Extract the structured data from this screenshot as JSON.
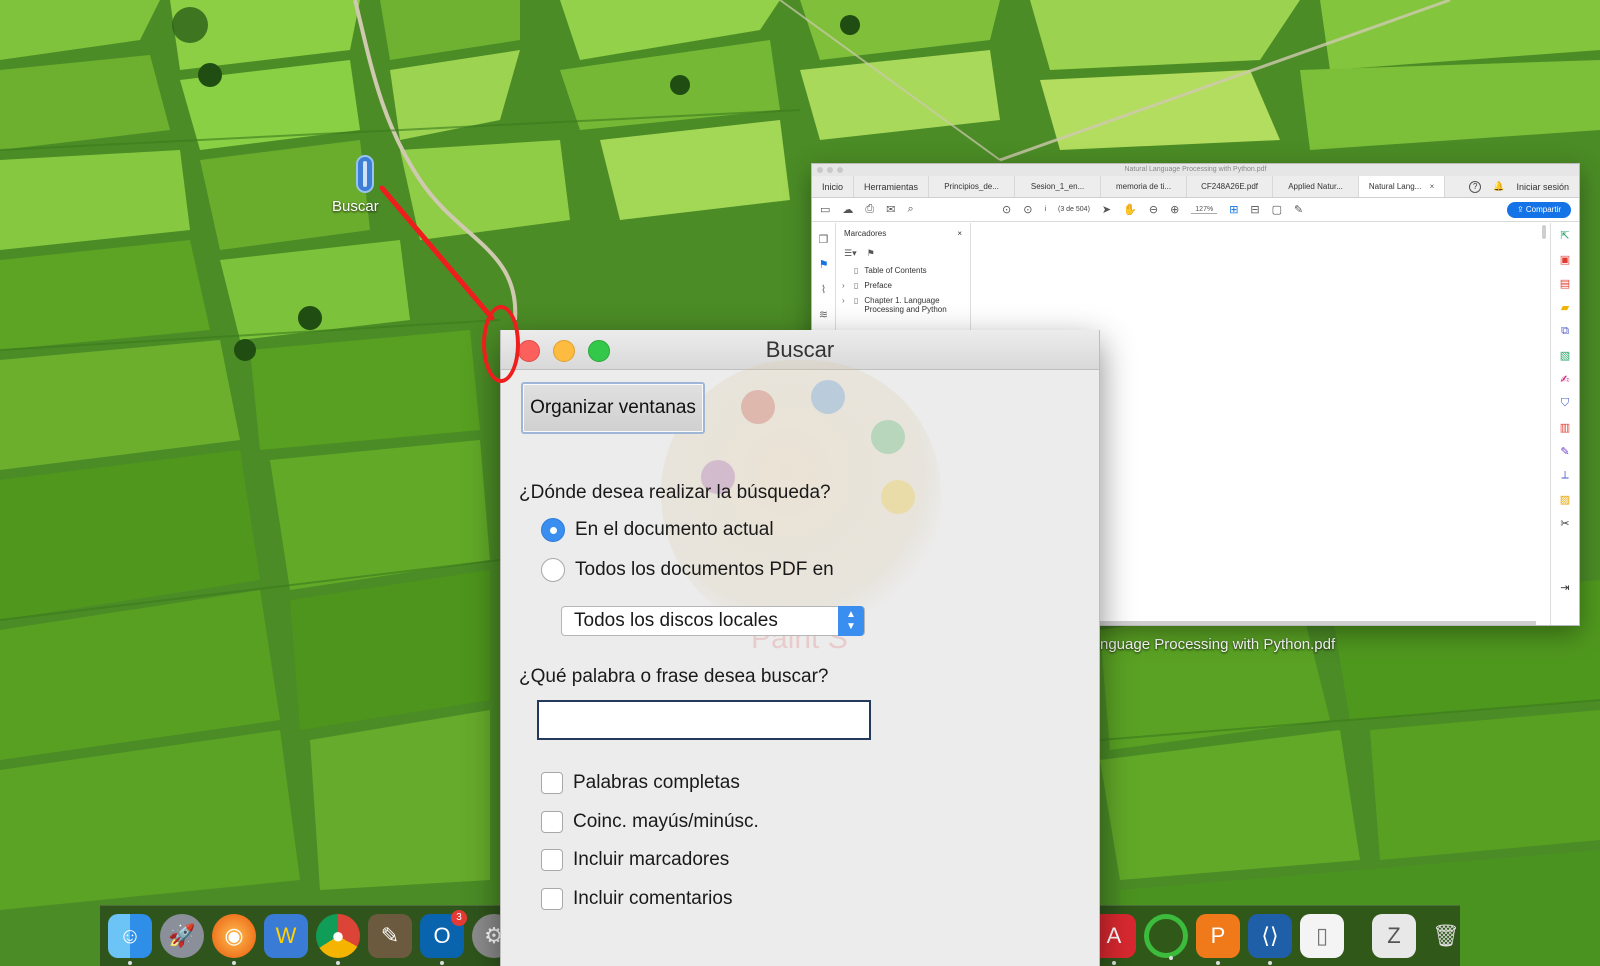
{
  "desktop": {
    "shortcut_label": "Buscar",
    "file_caption": "nguage Processing with Python.pdf"
  },
  "acrobat": {
    "title": "Natural Language Processing with Python.pdf",
    "tabs": [
      {
        "label": "Inicio"
      },
      {
        "label": "Herramientas"
      }
    ],
    "doc_tabs": [
      {
        "label": "Principios_de..."
      },
      {
        "label": "Sesion_1_en..."
      },
      {
        "label": "memoria de ti..."
      },
      {
        "label": "CF248A26E.pdf"
      },
      {
        "label": "Applied Natur..."
      },
      {
        "label": "Natural Lang...",
        "active": true
      }
    ],
    "help_label": "?",
    "signin_label": "Iniciar sesión",
    "page_value": "i",
    "page_count": "(3 de 504)",
    "zoom": "127%",
    "share_label": "Compartir",
    "bookmarks_title": "Marcadores",
    "bookmarks": [
      {
        "label": "Table of Contents"
      },
      {
        "label": "Preface"
      },
      {
        "label": "Chapter 1. Language Processing and Python"
      }
    ]
  },
  "dialog": {
    "title": "Buscar",
    "organize_button": "Organizar ventanas",
    "watermark_text": "Paint S",
    "where_question": "¿Dónde desea realizar la búsqueda?",
    "radio_current": "En el documento actual",
    "radio_all": "Todos los documentos PDF en",
    "location_select": "Todos los discos locales",
    "what_question": "¿Qué palabra o frase desea buscar?",
    "search_value": "",
    "options": [
      {
        "label": "Palabras completas"
      },
      {
        "label": "Coinc. mayús/minúsc."
      },
      {
        "label": "Incluir marcadores"
      },
      {
        "label": "Incluir comentarios"
      }
    ]
  },
  "dock": {
    "mail_badge": "3"
  }
}
